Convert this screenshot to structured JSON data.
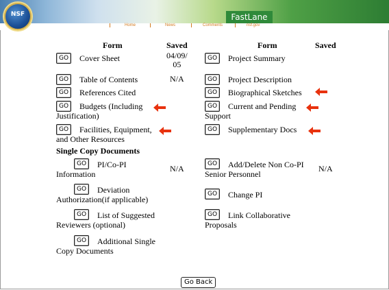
{
  "header": {
    "logo_text": "NSF",
    "brand": "FastLane",
    "nav": [
      "Home",
      "News",
      "Comments",
      "nsf.gov"
    ]
  },
  "columns": {
    "form": "Form",
    "saved": "Saved"
  },
  "left_forms": [
    {
      "label": "Cover Sheet",
      "saved": "04/09/\n05",
      "flag": false
    },
    {
      "label": "Table of Contents",
      "saved": "N/A",
      "flag": false
    },
    {
      "label": "References Cited",
      "saved": "",
      "flag": false
    },
    {
      "label_1": "Budgets (Including",
      "label_2": "Justification)",
      "flag": true
    },
    {
      "label_1": "Facilities, Equipment,",
      "label_2": "and Other Resources",
      "flag": true
    }
  ],
  "right_forms": [
    {
      "label": "Project Summary",
      "flag": false
    },
    {
      "label": "Project Description",
      "flag": false
    },
    {
      "label": "Biographical Sketches",
      "flag": true
    },
    {
      "label_1": "Current and Pending",
      "label_2": "Support",
      "flag": true
    },
    {
      "label": "Supplementary Docs",
      "flag": true
    }
  ],
  "single_copy": {
    "title": "Single Copy Documents",
    "pi": {
      "label_1": "PI/Co-PI",
      "label_2": "Information",
      "saved": "N/A"
    },
    "deviation": {
      "label_1": "Deviation",
      "label_2": "Authorization(if applicable)"
    },
    "reviewers": {
      "label_1": "List of Suggested",
      "label_2": "Reviewers (optional)"
    },
    "additional": {
      "label_1": "Additional Single",
      "label_2": "Copy Documents"
    },
    "noncopi": {
      "label_1": "Add/Delete Non Co-PI",
      "label_2": "Senior Personnel",
      "saved": "N/A"
    },
    "change_pi": {
      "label": "Change PI"
    },
    "link_collab": {
      "label_1": "Link Collaborative",
      "label_2": "Proposals"
    }
  },
  "buttons": {
    "go": "GO",
    "go_back": "Go Back"
  },
  "colors": {
    "arrow": "#e8320e",
    "brand_bg": "#2f8a3a"
  }
}
